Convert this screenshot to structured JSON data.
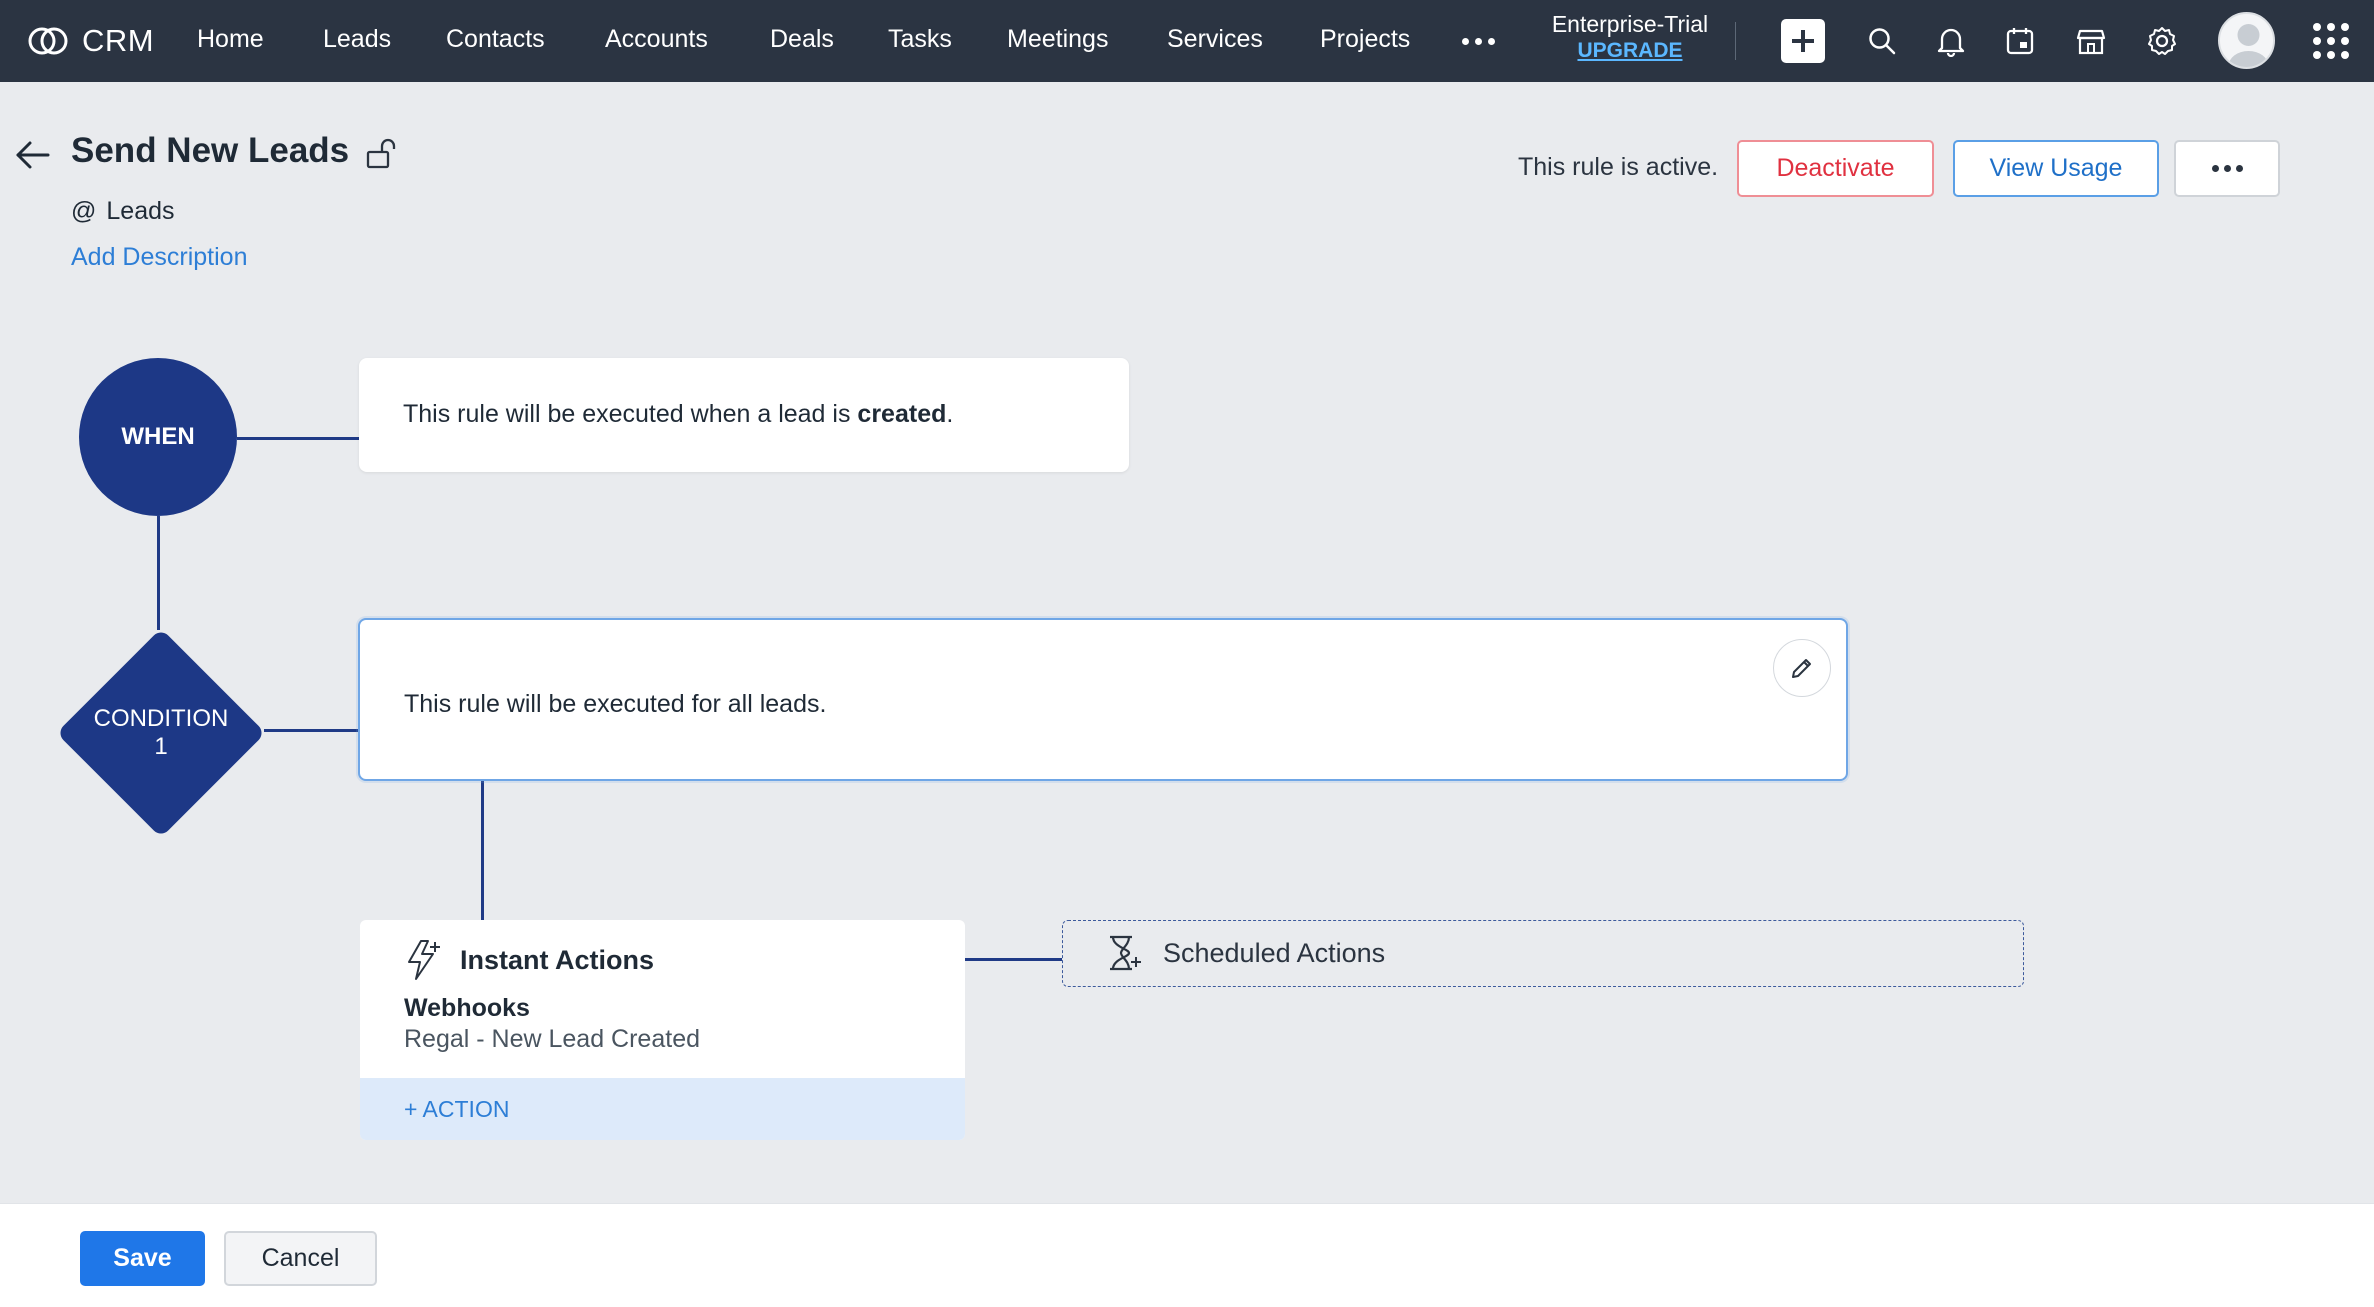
{
  "app": {
    "name": "CRM"
  },
  "nav": {
    "items": [
      {
        "label": "Home"
      },
      {
        "label": "Leads"
      },
      {
        "label": "Contacts"
      },
      {
        "label": "Accounts"
      },
      {
        "label": "Deals"
      },
      {
        "label": "Tasks"
      },
      {
        "label": "Meetings"
      },
      {
        "label": "Services"
      },
      {
        "label": "Projects"
      }
    ],
    "more_icon": "more-horizontal-icon",
    "plan": {
      "name": "Enterprise-Trial",
      "upgrade": "UPGRADE"
    },
    "icons": [
      "add-icon",
      "search-icon",
      "bell-icon",
      "calendar-icon",
      "store-icon",
      "gear-icon",
      "avatar",
      "apps-grid-icon"
    ]
  },
  "rule": {
    "title": "Send New Leads",
    "module_prefix": "@",
    "module": "Leads",
    "add_description": "Add Description",
    "status_text": "This rule is active.",
    "deactivate_label": "Deactivate",
    "view_usage_label": "View Usage"
  },
  "flow": {
    "when_label": "WHEN",
    "when_text_prefix": "This rule will be executed when a lead is ",
    "when_text_bold": "created",
    "when_text_suffix": ".",
    "condition_label_line1": "CONDITION",
    "condition_label_line2": "1",
    "condition_text": "This rule will be executed for all leads.",
    "instant": {
      "title": "Instant Actions",
      "action_type": "Webhooks",
      "action_name": "Regal - New Lead Created",
      "add_action": "+ ACTION"
    },
    "scheduled": {
      "title": "Scheduled Actions"
    }
  },
  "footer": {
    "save_label": "Save",
    "cancel_label": "Cancel"
  },
  "colors": {
    "topbar": "#2b3442",
    "flow_node": "#1d3886",
    "primary_button": "#1f77e8",
    "deactivate": "#e03140",
    "link": "#2d7ed6"
  }
}
